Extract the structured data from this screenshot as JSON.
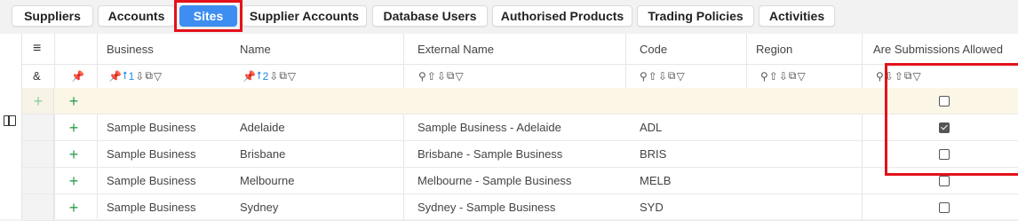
{
  "tabs": [
    {
      "label": "Suppliers",
      "active": false
    },
    {
      "label": "Accounts",
      "active": false
    },
    {
      "label": "Sites",
      "active": true
    },
    {
      "label": "Supplier Accounts",
      "active": false
    },
    {
      "label": "Database Users",
      "active": false
    },
    {
      "label": "Authorised Products",
      "active": false
    },
    {
      "label": "Trading Policies",
      "active": false
    },
    {
      "label": "Activities",
      "active": false
    }
  ],
  "grid": {
    "menu_glyph": "≡",
    "amp_glyph": "&",
    "columns": [
      {
        "label": "Business",
        "sort_index": "1"
      },
      {
        "label": "Name",
        "sort_index": "2"
      },
      {
        "label": "External Name"
      },
      {
        "label": "Code"
      },
      {
        "label": "Region"
      },
      {
        "label": "Are Submissions Allowed"
      }
    ],
    "rows": [
      {
        "business": "Sample Business",
        "name": "Adelaide",
        "external_name": "Sample Business - Adelaide",
        "code": "ADL",
        "region": "",
        "submissions_allowed": true
      },
      {
        "business": "Sample Business",
        "name": "Brisbane",
        "external_name": "Brisbane - Sample Business",
        "code": "BRIS",
        "region": "",
        "submissions_allowed": false
      },
      {
        "business": "Sample Business",
        "name": "Melbourne",
        "external_name": "Melbourne - Sample Business",
        "code": "MELB",
        "region": "",
        "submissions_allowed": false
      },
      {
        "business": "Sample Business",
        "name": "Sydney",
        "external_name": "Sydney - Sample Business",
        "code": "SYD",
        "region": "",
        "submissions_allowed": false
      }
    ],
    "new_row": {
      "submissions_allowed": false
    }
  },
  "colors": {
    "accent": "#3d8ef0",
    "highlight": "#e3121b",
    "add": "#2e9e4f",
    "pin_sort": "#1e88e5"
  }
}
